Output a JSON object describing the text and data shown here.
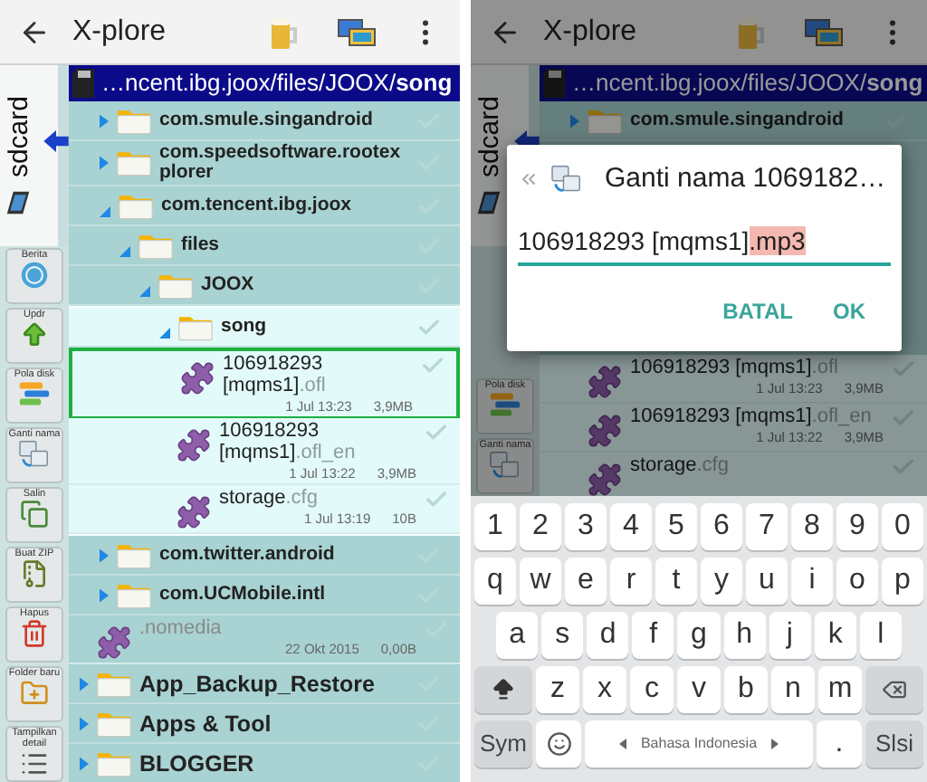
{
  "left_screen": {
    "app_bar": {
      "title": "X-plore"
    },
    "path": "…ncent.ibg.joox/files/JOOX/**song**",
    "storage_tab": {
      "label": "sdcard"
    },
    "tools": [
      {
        "kind": "info",
        "label": "Berita"
      },
      {
        "kind": "upload",
        "label": "Updr"
      },
      {
        "kind": "bars",
        "label": "Pola disk"
      },
      {
        "kind": "rename",
        "label": "Ganti nama"
      },
      {
        "kind": "copy",
        "label": "Salin"
      },
      {
        "kind": "zip",
        "label": "Buat ZIP"
      },
      {
        "kind": "trash",
        "label": "Hapus"
      },
      {
        "kind": "new-folder",
        "label": "Folder baru"
      },
      {
        "kind": "details",
        "label": "Tampilkan detail"
      }
    ],
    "tree": [
      {
        "kind": "group",
        "children": [
          {
            "kind": "folder",
            "name": "com.smule.singandroid",
            "expanded": false,
            "current": false
          },
          {
            "kind": "folder",
            "name": "com.speedsoftware.rootexplorer",
            "expanded": false,
            "current": false
          },
          {
            "kind": "folder",
            "name": "com.tencent.ibg.joox",
            "expanded": true,
            "current": false,
            "children": [
              {
                "kind": "folder",
                "name": "files",
                "expanded": true,
                "current": false,
                "children": [
                  {
                    "kind": "folder",
                    "name": "JOOX",
                    "expanded": true,
                    "current": false,
                    "children": [
                      {
                        "kind": "folder",
                        "name": "song",
                        "expanded": true,
                        "current": true,
                        "children": [
                          {
                            "kind": "file",
                            "name": "106918293 [mqms1]",
                            "ext": ".ofl",
                            "date": "1 Jul 13:23",
                            "size": "3,9MB",
                            "selected": true,
                            "hidden": false
                          },
                          {
                            "kind": "file",
                            "name": "106918293 [mqms1]",
                            "ext": ".ofl_en",
                            "date": "1 Jul 13:22",
                            "size": "3,9MB",
                            "selected": false,
                            "hidden": false
                          },
                          {
                            "kind": "file",
                            "name": "storage",
                            "ext": ".cfg",
                            "date": "1 Jul 13:19",
                            "size": "10B",
                            "selected": false,
                            "hidden": false
                          }
                        ]
                      }
                    ]
                  }
                ]
              }
            ]
          },
          {
            "kind": "folder",
            "name": "com.twitter.android",
            "expanded": false,
            "current": false
          },
          {
            "kind": "folder",
            "name": "com.UCMobile.intl",
            "expanded": false,
            "current": false
          },
          {
            "kind": "file",
            "name": ".nomedia",
            "date": "22 Okt 2015",
            "size": "0,00B",
            "selected": false,
            "hidden": true
          }
        ]
      },
      {
        "kind": "folder",
        "name": "App_Backup_Restore",
        "expanded": false,
        "current": false
      },
      {
        "kind": "folder",
        "name": "Apps & Tool",
        "expanded": false,
        "current": false
      },
      {
        "kind": "folder",
        "name": "BLOGGER",
        "expanded": false,
        "current": false
      }
    ]
  },
  "right_screen": {
    "app_bar": {
      "title": "X-plore"
    },
    "path": "…ncent.ibg.joox/files/JOOX/**song**",
    "storage_tab": {
      "label": "sdcard"
    },
    "tools": [
      {
        "kind": "bars",
        "label": "Pola disk"
      },
      {
        "kind": "rename",
        "label": "Ganti nama"
      }
    ],
    "rows_above": [
      {
        "kind": "folder",
        "name": "com.smule.singandroid",
        "expanded": false,
        "current": false
      }
    ],
    "rows_below": [
      {
        "kind": "file",
        "name": "106918293 [mqms1]",
        "ext": ".ofl",
        "date": "1 Jul 13:23",
        "size": "3,9MB",
        "selected": false,
        "hidden": false
      },
      {
        "kind": "file",
        "name": "106918293 [mqms1]",
        "ext": ".ofl_en",
        "date": "1 Jul 13:22",
        "size": "3,9MB",
        "selected": false,
        "hidden": false
      },
      {
        "kind": "file",
        "name": "storage",
        "ext": ".cfg",
        "selected": false,
        "hidden": false
      }
    ],
    "dialog": {
      "title": "Ganti nama 1069182…",
      "value": "106918293 [mqms1]",
      "selected_text": ".mp3",
      "buttons": [
        "BATAL",
        "OK"
      ]
    },
    "keyboard": {
      "rows": [
        {
          "keys": [
            {
              "kind": "text",
              "label": "1"
            },
            {
              "kind": "text",
              "label": "2"
            },
            {
              "kind": "text",
              "label": "3"
            },
            {
              "kind": "text",
              "label": "4"
            },
            {
              "kind": "text",
              "label": "5"
            },
            {
              "kind": "text",
              "label": "6"
            },
            {
              "kind": "text",
              "label": "7"
            },
            {
              "kind": "text",
              "label": "8"
            },
            {
              "kind": "text",
              "label": "9"
            },
            {
              "kind": "text",
              "label": "0"
            }
          ]
        },
        {
          "keys": [
            {
              "kind": "text",
              "label": "q"
            },
            {
              "kind": "text",
              "label": "w"
            },
            {
              "kind": "text",
              "label": "e"
            },
            {
              "kind": "text",
              "label": "r"
            },
            {
              "kind": "text",
              "label": "t"
            },
            {
              "kind": "text",
              "label": "y"
            },
            {
              "kind": "text",
              "label": "u"
            },
            {
              "kind": "text",
              "label": "i"
            },
            {
              "kind": "text",
              "label": "o"
            },
            {
              "kind": "text",
              "label": "p"
            }
          ]
        },
        {
          "keys": [
            {
              "kind": "text",
              "label": "a"
            },
            {
              "kind": "text",
              "label": "s"
            },
            {
              "kind": "text",
              "label": "d"
            },
            {
              "kind": "text",
              "label": "f"
            },
            {
              "kind": "text",
              "label": "g"
            },
            {
              "kind": "text",
              "label": "h"
            },
            {
              "kind": "text",
              "label": "j"
            },
            {
              "kind": "text",
              "label": "k"
            },
            {
              "kind": "text",
              "label": "l"
            }
          ]
        },
        {
          "keys": [
            {
              "kind": "shift"
            },
            {
              "kind": "text",
              "label": "z"
            },
            {
              "kind": "text",
              "label": "x"
            },
            {
              "kind": "text",
              "label": "c"
            },
            {
              "kind": "text",
              "label": "v"
            },
            {
              "kind": "text",
              "label": "b"
            },
            {
              "kind": "text",
              "label": "n"
            },
            {
              "kind": "text",
              "label": "m"
            },
            {
              "kind": "backspace"
            }
          ]
        },
        {
          "keys": [
            {
              "kind": "action",
              "label": "Sym"
            },
            {
              "kind": "emoji"
            },
            {
              "kind": "space",
              "label": "Bahasa Indonesia"
            },
            {
              "kind": "text",
              "label": "."
            },
            {
              "kind": "action",
              "label": "Slsi"
            }
          ]
        }
      ]
    }
  }
}
